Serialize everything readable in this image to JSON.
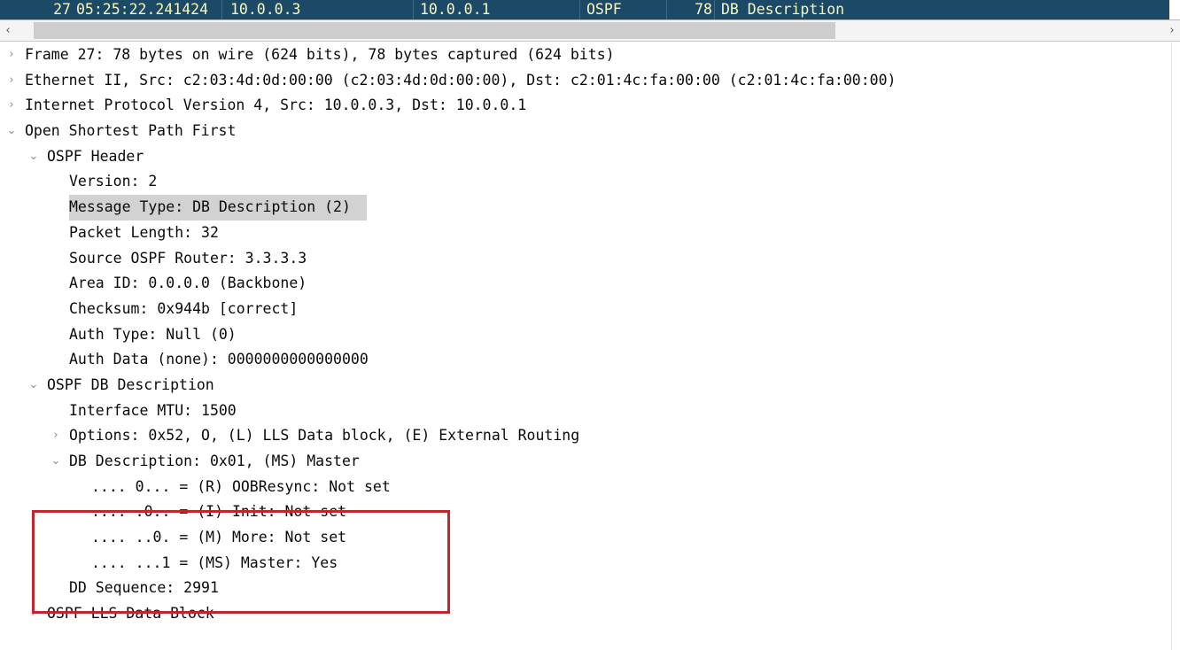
{
  "packet_list": {
    "selected_row": {
      "no": "27",
      "time": "05:25:22.241424",
      "source": "10.0.0.3",
      "destination": "10.0.0.1",
      "protocol": "OSPF",
      "length": "78",
      "info": "DB Description"
    },
    "scrollbar": {
      "left_arrow": "‹",
      "right_arrow": "›"
    }
  },
  "detail_tree": {
    "rows": [
      {
        "level": 0,
        "chevron": "›",
        "text": "Frame 27: 78 bytes on wire (624 bits), 78 bytes captured (624 bits)",
        "highlight": false
      },
      {
        "level": 0,
        "chevron": "›",
        "text": "Ethernet II, Src: c2:03:4d:0d:00:00 (c2:03:4d:0d:00:00), Dst: c2:01:4c:fa:00:00 (c2:01:4c:fa:00:00)",
        "highlight": false
      },
      {
        "level": 0,
        "chevron": "›",
        "text": "Internet Protocol Version 4, Src: 10.0.0.3, Dst: 10.0.0.1",
        "highlight": false
      },
      {
        "level": 0,
        "chevron": "⌄",
        "text": "Open Shortest Path First",
        "highlight": false
      },
      {
        "level": 1,
        "chevron": "⌄",
        "text": "OSPF Header",
        "highlight": false
      },
      {
        "level": 2,
        "chevron": "",
        "text": "Version: 2",
        "highlight": false
      },
      {
        "level": 2,
        "chevron": "",
        "text": "Message Type: DB Description (2)",
        "highlight": true
      },
      {
        "level": 2,
        "chevron": "",
        "text": "Packet Length: 32",
        "highlight": false
      },
      {
        "level": 2,
        "chevron": "",
        "text": "Source OSPF Router: 3.3.3.3",
        "highlight": false
      },
      {
        "level": 2,
        "chevron": "",
        "text": "Area ID: 0.0.0.0 (Backbone)",
        "highlight": false
      },
      {
        "level": 2,
        "chevron": "",
        "text": "Checksum: 0x944b [correct]",
        "highlight": false
      },
      {
        "level": 2,
        "chevron": "",
        "text": "Auth Type: Null (0)",
        "highlight": false
      },
      {
        "level": 2,
        "chevron": "",
        "text": "Auth Data (none): 0000000000000000",
        "highlight": false
      },
      {
        "level": 1,
        "chevron": "⌄",
        "text": "OSPF DB Description",
        "highlight": false
      },
      {
        "level": 2,
        "chevron": "",
        "text": "Interface MTU: 1500",
        "highlight": false
      },
      {
        "level": 2,
        "chevron": "›",
        "text": "Options: 0x52, O, (L) LLS Data block, (E) External Routing",
        "highlight": false
      },
      {
        "level": 2,
        "chevron": "⌄",
        "text": "DB Description: 0x01, (MS) Master",
        "highlight": false
      },
      {
        "level": 3,
        "chevron": "",
        "text": ".... 0... = (R) OOBResync: Not set",
        "highlight": false
      },
      {
        "level": 3,
        "chevron": "",
        "text": ".... .0.. = (I) Init: Not set",
        "highlight": false
      },
      {
        "level": 3,
        "chevron": "",
        "text": ".... ..0. = (M) More: Not set",
        "highlight": false
      },
      {
        "level": 3,
        "chevron": "",
        "text": ".... ...1 = (MS) Master: Yes",
        "highlight": false
      },
      {
        "level": 2,
        "chevron": "",
        "text": "DD Sequence: 2991",
        "highlight": false
      },
      {
        "level": 1,
        "chevron": "›",
        "text": "OSPF LLS Data Block",
        "highlight": false
      }
    ]
  },
  "annotation": {
    "red_box_color": "#c0272d"
  },
  "colors": {
    "selected_row_bg": "#1c4966",
    "selected_row_fg": "#f7f8c0",
    "field_highlight_bg": "#d2d2d2"
  }
}
